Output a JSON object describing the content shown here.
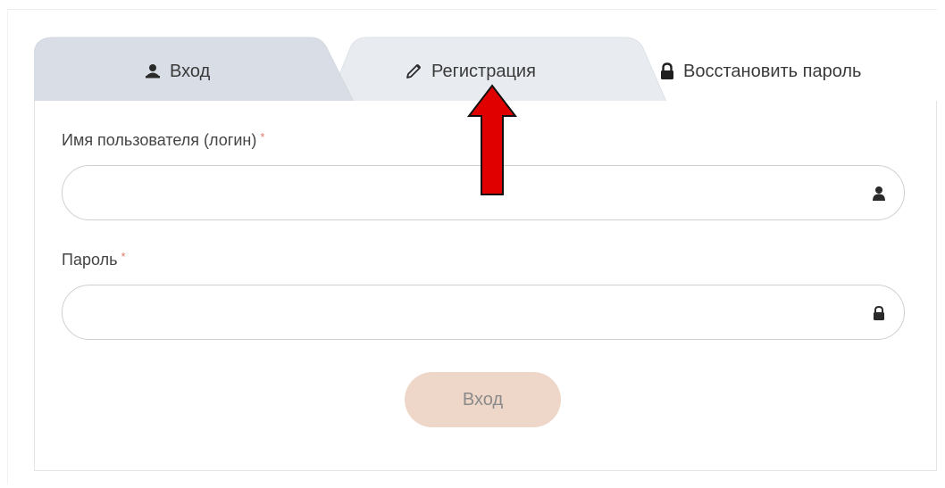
{
  "tabs": {
    "login": {
      "label": "Вход",
      "icon": "user-icon"
    },
    "register": {
      "label": "Регистрация",
      "icon": "pencil-icon"
    },
    "restore": {
      "label": "Восстановить пароль",
      "icon": "lock-icon"
    }
  },
  "form": {
    "username": {
      "label": "Имя пользователя (логин)",
      "required_mark": "*",
      "value": "",
      "placeholder": "",
      "icon": "user-icon"
    },
    "password": {
      "label": "Пароль",
      "required_mark": "*",
      "value": "",
      "placeholder": "",
      "icon": "lock-icon"
    },
    "submit_label": "Вход"
  },
  "annotation": {
    "arrow_color": "#e00000",
    "icon": "red-arrow-up-icon"
  },
  "colors": {
    "active_tab_bg": "#d9dee6",
    "inactive_tab_bg": "#e8ecf0",
    "submit_bg": "#eed7c8",
    "required_mark": "#e07a6e"
  }
}
